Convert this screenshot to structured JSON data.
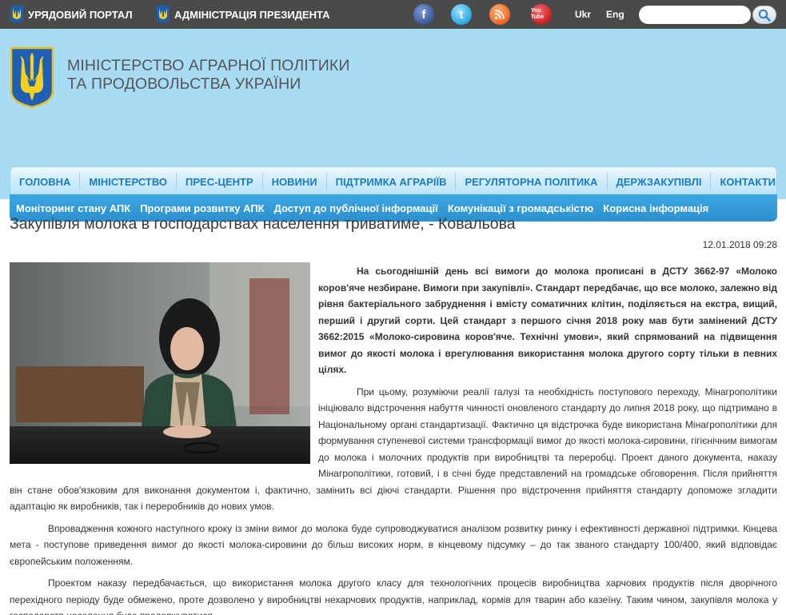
{
  "topbar": {
    "links": [
      {
        "label": "УРЯДОВИЙ ПОРТАЛ"
      },
      {
        "label": "АДМІНІСТРАЦІЯ ПРЕЗИДЕНТА"
      }
    ],
    "social": [
      {
        "icon": "facebook-icon",
        "glyph": "f",
        "color": "#3b5998"
      },
      {
        "icon": "twitter-icon",
        "glyph": "t",
        "color": "#2aa9e0"
      },
      {
        "icon": "rss-icon",
        "glyph": ")",
        "color": "#f26522"
      },
      {
        "icon": "youtube-icon",
        "glyph": "You Tube",
        "color": "#cc1f1f"
      }
    ],
    "languages": [
      "Ukr",
      "Eng"
    ],
    "search": {
      "placeholder": "",
      "value": ""
    }
  },
  "header": {
    "title_line1": "Міністерство аграрної політики",
    "title_line2": "та продовольства України",
    "bg_color": "#a8dcf5"
  },
  "menu_primary": [
    "ГОЛОВНА",
    "МІНІСТЕРСТВО",
    "ПРЕС-ЦЕНТР",
    "НОВИНИ",
    "ПІДТРИМКА АГРАРІЇВ",
    "РЕГУЛЯТОРНА ПОЛІТИКА",
    "ДЕРЖЗАКУПІВЛІ",
    "КОНТАКТИ"
  ],
  "menu_secondary": [
    "Моніторинг стану АПК",
    "Програми розвитку АПК",
    "Доступ до публічної інформації",
    "Комунікації з громадськістю",
    "Корисна інформація"
  ],
  "article": {
    "title": "Закупівля молока в господарствах населення триватиме, - Ковальова",
    "date": "12.01.2018 09:28",
    "paragraphs": [
      "На сьогоднішній день всі вимоги до молока прописані в ДСТУ 3662-97 «Молоко коров'яче незбиране. Вимоги при закупівлі». Стандарт передбачає, що все молоко, залежно від рівня бактеріального забруднення і вмісту соматичних клітин, поділяється на екстра, вищий, перший і другий сорти. Цей стандарт з першого січня 2018 року мав бути замінений ДСТУ 3662:2015 «Молоко-сировина коров'яче. Технічні умови», який спрямований на підвищення вимог до якості молока і врегулювання використання молока другого сорту тільки в певних цілях.",
      "При цьому, розуміючи реалії галузі та необхідність поступового переходу, Мінагрополітики ініціювало відстрочення набуття чинності оновленого стандарту до липня 2018 року, що підтримано в Національному органі стандартизації. Фактично ця відстрочка буде використана Мінагрополітики для формування ступеневої системи трансформації вимог до якості молока-сировини, гігієнічним вимогам до молока і молочних продуктів при виробництві та переробці. Проект даного документа, наказу Мінагрополітики, готовий, і в січні буде представлений на громадське обговорення. Після прийняття він стане обов'язковим для виконання документом і, фактично, замінить всі діючі стандарти. Рішення про відстрочення прийняття стандарту допоможе згладити адаптацію як виробників, так і переробників до нових умов.",
      "Впровадження кожного наступного кроку із зміни вимог до молока буде супроводжуватися аналізом розвитку ринку і ефективності державної підтримки. Кінцева мета - поступове приведення вимог до якості молока-сировини до більш високих норм, в кінцевому підсумку – до так званого стандарту 100/400, який відповідає європейським положенням.",
      "Проектом наказу передбачається, що використання молока другого класу для технологічних процесів виробництва харчових продуктів після дворічного перехідного періоду буде обмежено, проте дозволено у виробництві нехарчових продуктів, наприклад, кормів для тварин або казеїну. Таким чином, закупівля молока у господарств населення буде продовжуватися."
    ]
  }
}
